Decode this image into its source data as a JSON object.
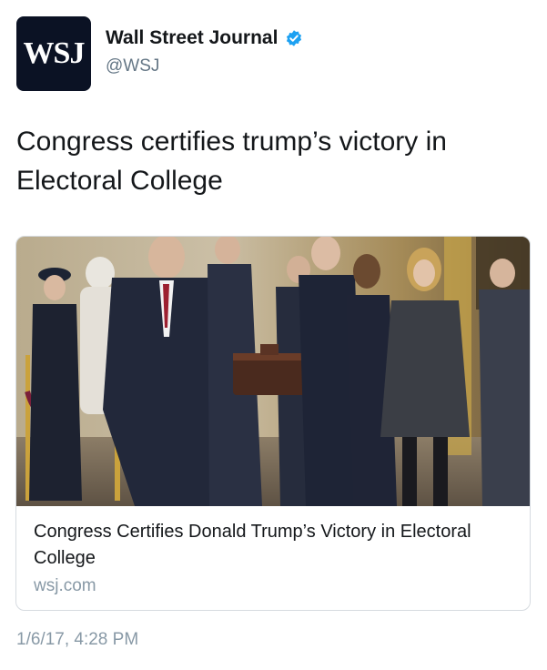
{
  "account": {
    "avatar_text": "WSJ",
    "display_name": "Wall Street Journal",
    "handle": "@WSJ",
    "verified": true
  },
  "tweet": {
    "text": "Congress certifies trump’s victory in Electoral College",
    "timestamp": "1/6/17, 4:28 PM"
  },
  "card": {
    "image": "photo-people-carrying-box-in-capitol-hallway",
    "title": "Congress Certifies Donald Trump’s Victory in Electoral College",
    "domain": "wsj.com"
  },
  "colors": {
    "avatar_bg": "#0b1224",
    "verified_blue": "#1da1f2",
    "secondary_text": "#657786",
    "muted_text": "#8899a6",
    "card_border": "#d6dbe0"
  }
}
